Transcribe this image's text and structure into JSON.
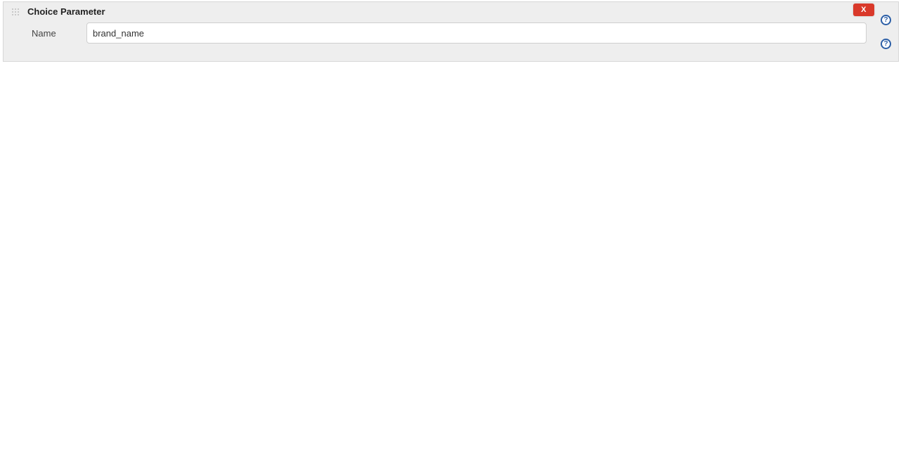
{
  "panel": {
    "title": "Choice Parameter",
    "close_label": "X"
  },
  "fields": {
    "name": {
      "label": "Name",
      "value": "brand_name"
    }
  },
  "help_glyph": "?"
}
